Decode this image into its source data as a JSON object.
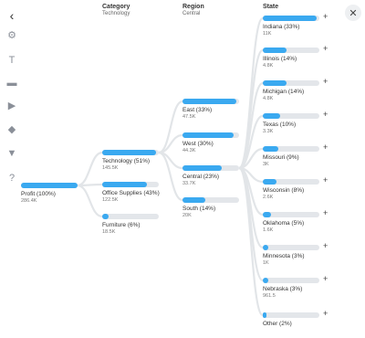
{
  "toolbar": {
    "back_icon": "‹",
    "items": [
      {
        "name": "settings-icon",
        "glyph": "⚙"
      },
      {
        "name": "text-format-icon",
        "glyph": "T"
      },
      {
        "name": "label-icon",
        "glyph": "▬"
      },
      {
        "name": "play-icon",
        "glyph": "▶"
      },
      {
        "name": "layers-icon",
        "glyph": "◆"
      },
      {
        "name": "filter-icon",
        "glyph": "▼"
      },
      {
        "name": "help-icon",
        "glyph": "?"
      }
    ],
    "close_icon": "✕"
  },
  "columns": [
    {
      "title": "Category",
      "subtitle": "Technology"
    },
    {
      "title": "Region",
      "subtitle": "Central"
    },
    {
      "title": "State",
      "subtitle": ""
    }
  ],
  "root": {
    "label": "Profit (100%)",
    "value": "286.4K",
    "fraction": 1.0
  },
  "categories": [
    {
      "label": "Technology (51%)",
      "value": "145.5K",
      "fraction": 0.95
    },
    {
      "label": "Office Supplies (43%)",
      "value": "122.5K",
      "fraction": 0.79
    },
    {
      "label": "Furniture (6%)",
      "value": "18.5K",
      "fraction": 0.12
    }
  ],
  "regions": [
    {
      "label": "East (33%)",
      "value": "47.5K",
      "fraction": 0.95
    },
    {
      "label": "West (30%)",
      "value": "44.3K",
      "fraction": 0.91
    },
    {
      "label": "Central (23%)",
      "value": "33.7K",
      "fraction": 0.7
    },
    {
      "label": "South (14%)",
      "value": "20K",
      "fraction": 0.4
    }
  ],
  "states": [
    {
      "label": "Indiana (33%)",
      "value": "11K",
      "fraction": 0.95
    },
    {
      "label": "Illinois (14%)",
      "value": "4.8K",
      "fraction": 0.42
    },
    {
      "label": "Michigan (14%)",
      "value": "4.8K",
      "fraction": 0.42
    },
    {
      "label": "Texas (10%)",
      "value": "3.3K",
      "fraction": 0.3
    },
    {
      "label": "Missouri (9%)",
      "value": "3K",
      "fraction": 0.27
    },
    {
      "label": "Wisconsin (8%)",
      "value": "2.6K",
      "fraction": 0.24
    },
    {
      "label": "Oklahoma (5%)",
      "value": "1.6K",
      "fraction": 0.14
    },
    {
      "label": "Minnesota (3%)",
      "value": "1K",
      "fraction": 0.09
    },
    {
      "label": "Nebraska (3%)",
      "value": "961.5",
      "fraction": 0.09
    },
    {
      "label": "Other (2%)",
      "value": "",
      "fraction": 0.06
    }
  ],
  "expand_label": "+",
  "colors": {
    "accent": "#3aa9f0",
    "track": "#e3e6ea",
    "link": "#e2e5e8"
  }
}
